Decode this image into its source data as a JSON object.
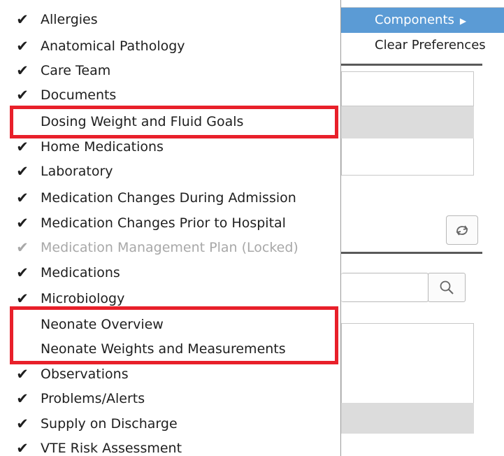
{
  "context_menu": {
    "items": [
      {
        "label": "Components",
        "has_submenu": true,
        "highlighted": true
      },
      {
        "label": "Clear Preferences",
        "has_submenu": false,
        "highlighted": false
      }
    ]
  },
  "components": {
    "items": [
      {
        "label": "Allergies",
        "checked": true,
        "locked": false
      },
      {
        "label": "Anatomical Pathology",
        "checked": true,
        "locked": false
      },
      {
        "label": "Care Team",
        "checked": true,
        "locked": false
      },
      {
        "label": "Documents",
        "checked": true,
        "locked": false
      },
      {
        "label": "Dosing Weight and Fluid Goals",
        "checked": false,
        "locked": false
      },
      {
        "label": "Home Medications",
        "checked": true,
        "locked": false
      },
      {
        "label": "Laboratory",
        "checked": true,
        "locked": false
      },
      {
        "label": "Medication Changes During Admission",
        "checked": true,
        "locked": false
      },
      {
        "label": "Medication Changes Prior to Hospital",
        "checked": true,
        "locked": false
      },
      {
        "label": "Medication Management Plan (Locked)",
        "checked": true,
        "locked": true
      },
      {
        "label": "Medications",
        "checked": true,
        "locked": false
      },
      {
        "label": "Microbiology",
        "checked": true,
        "locked": false
      },
      {
        "label": "Neonate Overview",
        "checked": false,
        "locked": false
      },
      {
        "label": "Neonate Weights and Measurements",
        "checked": false,
        "locked": false
      },
      {
        "label": "Observations",
        "checked": true,
        "locked": false
      },
      {
        "label": "Problems/Alerts",
        "checked": true,
        "locked": false
      },
      {
        "label": "Supply on Discharge",
        "checked": true,
        "locked": false
      },
      {
        "label": "VTE Risk Assessment",
        "checked": true,
        "locked": false
      }
    ]
  },
  "icons": {
    "check": "check-icon",
    "submenu_arrow": "triangle-right-icon",
    "refresh": "refresh-icon",
    "search": "search-icon"
  },
  "colors": {
    "highlight": "#5b9bd5",
    "annotation_red": "#e8202a",
    "locked_text": "#a8a8a8"
  }
}
